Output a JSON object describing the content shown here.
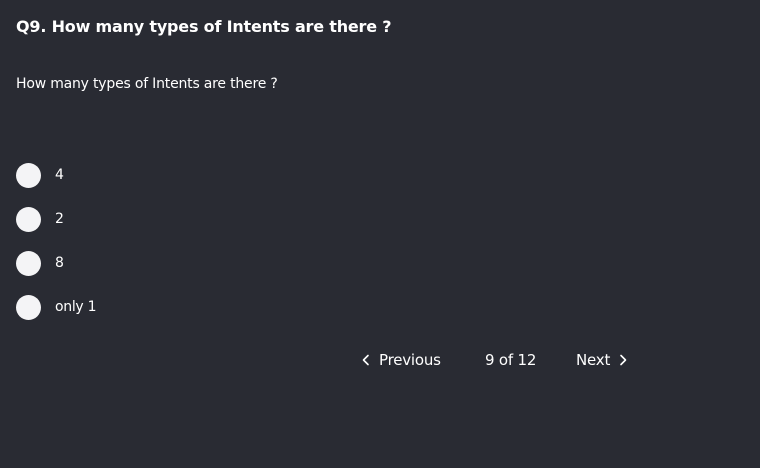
{
  "question": {
    "title": "Q9. How many types of Intents are there ?",
    "text": "How many types of Intents are there ?"
  },
  "options": [
    {
      "label": "4"
    },
    {
      "label": "2"
    },
    {
      "label": "8"
    },
    {
      "label": "only 1"
    }
  ],
  "pager": {
    "previous_label": "Previous",
    "count_label": "9 of 12",
    "next_label": "Next"
  },
  "icons": {
    "previous": "chevron-left-icon",
    "next": "chevron-right-icon"
  },
  "colors": {
    "background": "#292b33",
    "text": "#ffffff",
    "radio_fill": "#f4f4f6"
  }
}
